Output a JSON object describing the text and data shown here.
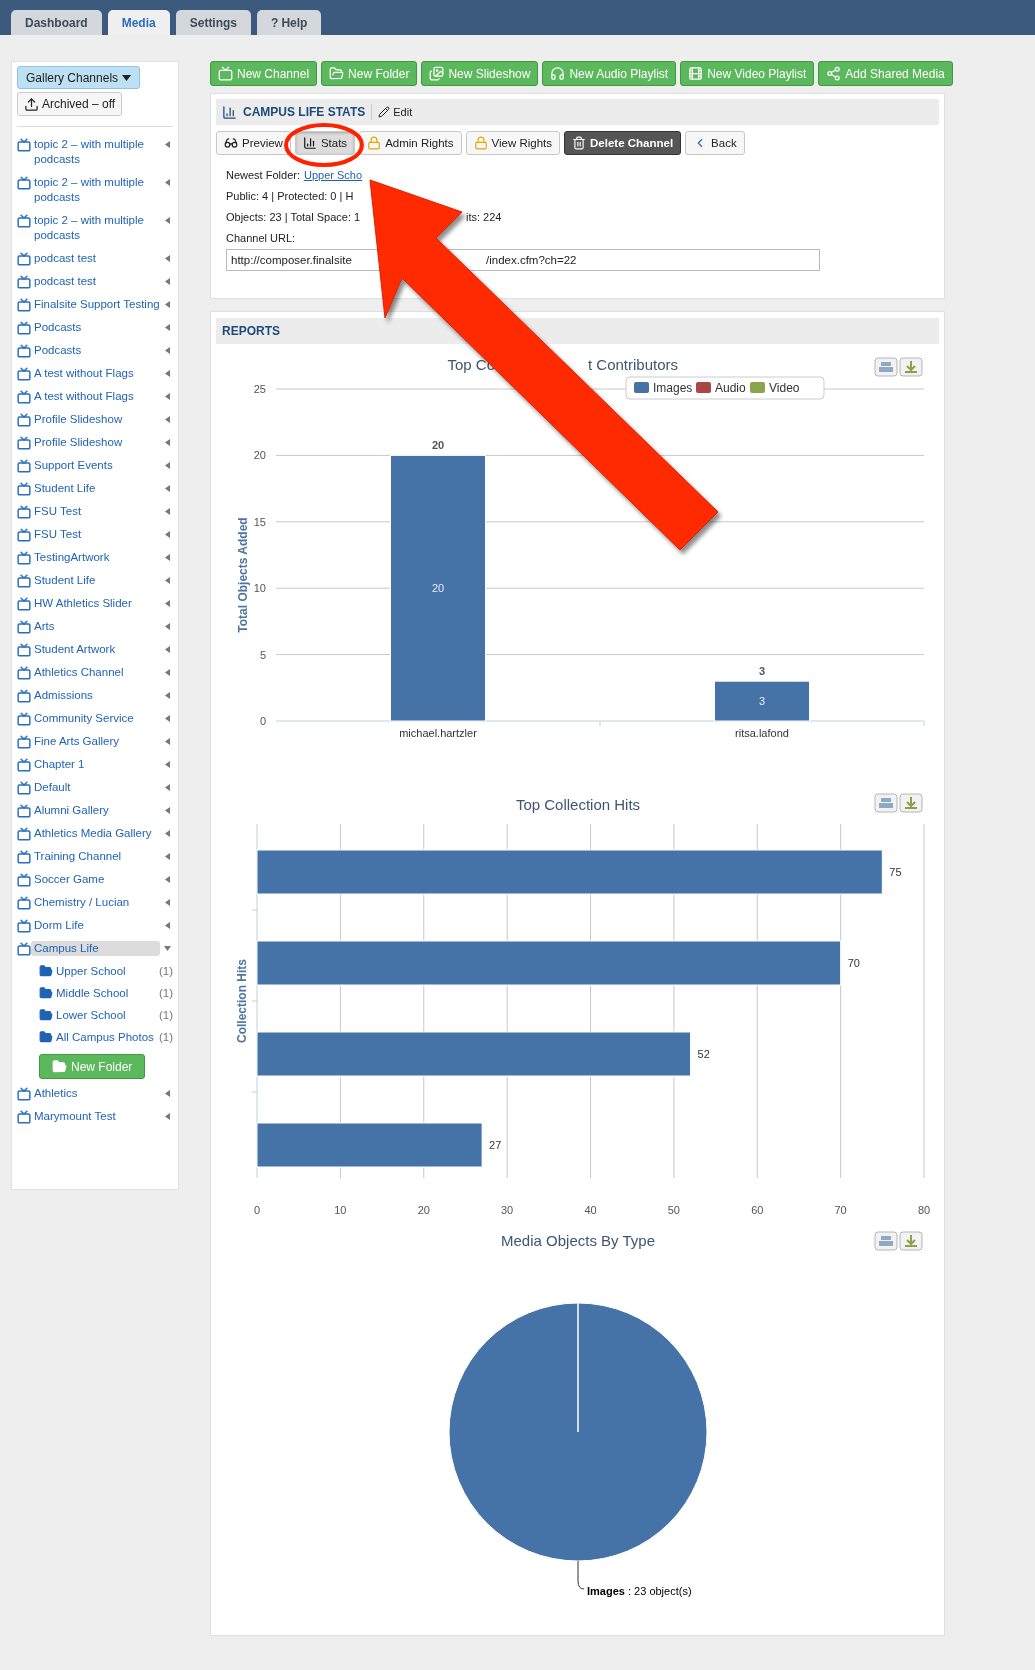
{
  "nav_tabs": [
    {
      "label": "Dashboard",
      "selected": false
    },
    {
      "label": "Media",
      "selected": true
    },
    {
      "label": "Settings",
      "selected": false
    },
    {
      "label": "Help",
      "glyph": "?",
      "selected": false
    }
  ],
  "sidebar": {
    "channels_button": "Gallery Channels",
    "archived_button": "Archived – off",
    "channels": [
      {
        "name": "topic 2 – with multiple podcasts",
        "selected": false,
        "expanded": false
      },
      {
        "name": "topic 2 – with multiple podcasts",
        "selected": false,
        "expanded": false
      },
      {
        "name": "topic 2 – with multiple podcasts",
        "selected": false,
        "expanded": false
      },
      {
        "name": "podcast test",
        "selected": false,
        "expanded": false
      },
      {
        "name": "podcast test",
        "selected": false,
        "expanded": false
      },
      {
        "name": "Finalsite Support Testing",
        "selected": false,
        "expanded": false
      },
      {
        "name": "Podcasts",
        "selected": false,
        "expanded": false
      },
      {
        "name": "Podcasts",
        "selected": false,
        "expanded": false
      },
      {
        "name": "A test without Flags",
        "selected": false,
        "expanded": false
      },
      {
        "name": "A test without Flags",
        "selected": false,
        "expanded": false
      },
      {
        "name": "Profile Slideshow",
        "selected": false,
        "expanded": false
      },
      {
        "name": "Profile Slideshow",
        "selected": false,
        "expanded": false
      },
      {
        "name": "Support Events",
        "selected": false,
        "expanded": false
      },
      {
        "name": "Student Life",
        "selected": false,
        "expanded": false
      },
      {
        "name": "FSU Test",
        "selected": false,
        "expanded": false
      },
      {
        "name": "FSU Test",
        "selected": false,
        "expanded": false
      },
      {
        "name": "TestingArtwork",
        "selected": false,
        "expanded": false
      },
      {
        "name": "Student Life",
        "selected": false,
        "expanded": false
      },
      {
        "name": "HW Athletics Slider",
        "selected": false,
        "expanded": false
      },
      {
        "name": "Arts",
        "selected": false,
        "expanded": false
      },
      {
        "name": "Student Artwork",
        "selected": false,
        "expanded": false
      },
      {
        "name": "Athletics Channel",
        "selected": false,
        "expanded": false
      },
      {
        "name": "Admissions",
        "selected": false,
        "expanded": false
      },
      {
        "name": "Community Service",
        "selected": false,
        "expanded": false
      },
      {
        "name": "Fine Arts Gallery",
        "selected": false,
        "expanded": false
      },
      {
        "name": "Chapter 1",
        "selected": false,
        "expanded": false
      },
      {
        "name": "Default",
        "selected": false,
        "expanded": false
      },
      {
        "name": "Alumni Gallery",
        "selected": false,
        "expanded": false
      },
      {
        "name": "Athletics Media Gallery",
        "selected": false,
        "expanded": false
      },
      {
        "name": "Training Channel",
        "selected": false,
        "expanded": false
      },
      {
        "name": "Soccer Game",
        "selected": false,
        "expanded": false
      },
      {
        "name": "Chemistry / Lucian",
        "selected": false,
        "expanded": false
      },
      {
        "name": "Dorm Life",
        "selected": false,
        "expanded": false
      },
      {
        "name": "Campus Life",
        "selected": true,
        "expanded": true,
        "folders": [
          {
            "name": "Upper School",
            "count": "(1)"
          },
          {
            "name": "Middle School",
            "count": "(1)"
          },
          {
            "name": "Lower School",
            "count": "(1)"
          },
          {
            "name": "All Campus Photos",
            "count": "(1)"
          }
        ],
        "new_folder_button": "New Folder"
      },
      {
        "name": "Athletics",
        "selected": false,
        "expanded": false
      },
      {
        "name": "Marymount Test",
        "selected": false,
        "expanded": false
      }
    ]
  },
  "toolbar": [
    "New Channel",
    "New Folder",
    "New Slideshow",
    "New Audio Playlist",
    "New Video Playlist",
    "Add Shared Media"
  ],
  "channel": {
    "title": "CAMPUS LIFE STATS",
    "edit_label": "Edit",
    "actions": [
      {
        "label": "Preview",
        "kind": "plain",
        "selected": false
      },
      {
        "label": "Stats",
        "kind": "plain",
        "selected": true
      },
      {
        "label": "Admin Rights",
        "kind": "plain",
        "selected": false
      },
      {
        "label": "View Rights",
        "kind": "plain",
        "selected": false
      },
      {
        "label": "Delete Channel",
        "kind": "dark",
        "selected": false
      },
      {
        "label": "Back",
        "kind": "plain",
        "selected": false
      }
    ],
    "info": {
      "newest_label": "Newest Folder:",
      "newest_link": "Upper Scho",
      "counts": "Public: 4 | Protected: 0 | H",
      "objects_start": "Objects: 23 | Total Space: 1",
      "objects_end": "its: 224",
      "url_label": "Channel URL:",
      "url_start": "http://composer.finalsite",
      "url_end": "/index.cfm?ch=22"
    }
  },
  "reports": {
    "title": "REPORTS",
    "charts": [
      {
        "title_parts": [
          "Top Co",
          "t Contributors"
        ],
        "chart_data": {
          "type": "bar",
          "stacked": true,
          "categories": [
            "michael.hartzler",
            "ritsa.lafond"
          ],
          "series": [
            {
              "name": "Images",
              "color": "#4572a7",
              "values": [
                20,
                3
              ],
              "value_labels": [
                "20",
                "3"
              ]
            },
            {
              "name": "Audio",
              "color": "#aa4643",
              "values": [
                0,
                0
              ],
              "value_labels": [
                null,
                null
              ]
            },
            {
              "name": "Video",
              "color": "#89a54e",
              "values": [
                0,
                0
              ],
              "value_labels": [
                null,
                null
              ]
            }
          ],
          "annotations": [
            "20",
            "3"
          ],
          "ylabel": "Total Objects Added",
          "ylim": [
            0,
            25
          ],
          "yticks": [
            0,
            5,
            10,
            15,
            20,
            25
          ],
          "grid": true
        }
      },
      {
        "chart_data": {
          "type": "bar",
          "orientation": "horizontal",
          "title": "Top Collection Hits",
          "ylabel": "Collection Hits",
          "values": [
            75,
            70,
            52,
            27
          ],
          "xlim": [
            0,
            80
          ],
          "xticks": [
            0,
            10,
            20,
            30,
            40,
            50,
            60,
            70,
            80
          ],
          "data_labels": true,
          "grid": true
        }
      },
      {
        "chart_data": {
          "type": "pie",
          "title": "Media Objects By Type",
          "categories": [
            "Images"
          ],
          "values": [
            23
          ],
          "value_labels": [
            ": 23 object(s)"
          ]
        }
      }
    ]
  }
}
